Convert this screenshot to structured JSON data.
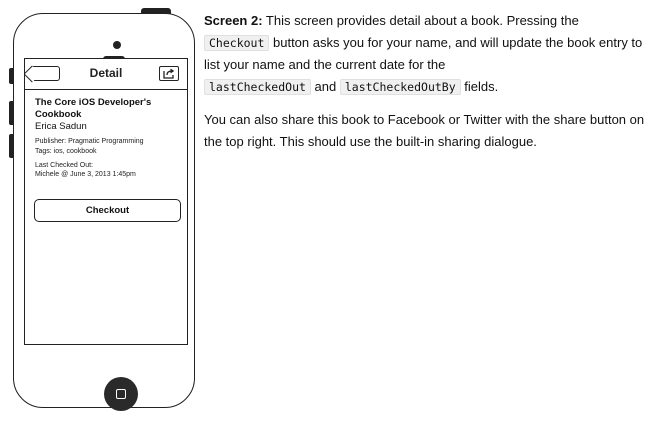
{
  "phone": {
    "nav_title": "Detail",
    "book_title": "The Core iOS Developer's Cookbook",
    "author": "Erica Sadun",
    "publisher": "Publisher: Pragmatic Programming",
    "tags": "Tags: ios, cookbook",
    "last_checked_out_label": "Last Checked Out:",
    "last_checked_out_value": "Michele @ June 3, 2013 1:45pm",
    "checkout_button": "Checkout"
  },
  "description": {
    "heading": "Screen 2:",
    "p1_a": " This screen provides detail about a book. Pressing the",
    "code_checkout": "Checkout",
    "p1_b": " button asks you for your name, and will update the book entry to list your name and the current date for the ",
    "code_last_checked_out": "lastCheckedOut",
    "p1_and": " and ",
    "code_last_checked_out_by": "lastCheckedOutBy",
    "p1_c": " fields.",
    "p2": "You can also share this book to Facebook or Twitter with the share button on the top right. This should use the built-in sharing dialogue."
  }
}
